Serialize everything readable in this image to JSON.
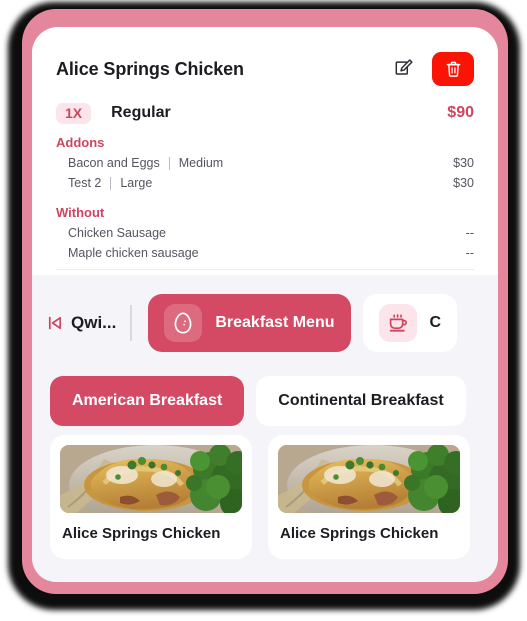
{
  "order": {
    "title": "Alice Springs Chicken",
    "edit_icon": "edit-pencil-square-icon",
    "delete_icon": "trash-icon",
    "quantity": "1X",
    "variant": "Regular",
    "price": "$90",
    "addons_label": "Addons",
    "addons": [
      {
        "name": "Bacon and Eggs",
        "size": "Medium",
        "price": "$30"
      },
      {
        "name": "Test 2",
        "size": "Large",
        "price": "$30"
      }
    ],
    "without_label": "Without",
    "without": [
      {
        "name": "Chicken Sausage",
        "price": "--"
      },
      {
        "name": "Maple chicken sausage",
        "price": "--"
      }
    ]
  },
  "menu_strip": {
    "back_icon": "skip-back-icon",
    "back_label": "Qwi...",
    "tabs": [
      {
        "label": "Breakfast Menu",
        "icon": "egg-icon",
        "active": true
      },
      {
        "label": "C",
        "icon": "coffee-cup-icon",
        "active": false
      }
    ]
  },
  "categories": [
    {
      "label": "American Breakfast",
      "active": true
    },
    {
      "label": "Continental Breakfast",
      "active": false
    }
  ],
  "dishes": [
    {
      "name": "Alice Springs Chicken",
      "image": "chicken-broccoli-plate-photo"
    },
    {
      "name": "Alice Springs Chicken",
      "image": "chicken-broccoli-plate-photo"
    }
  ],
  "colors": {
    "accent": "#cf455f",
    "tab_active": "#d44963",
    "delete": "#fa1405",
    "badge_bg": "#fbe5ea",
    "bezel": "#e4879d",
    "screen_bg": "#f5f5f9"
  }
}
